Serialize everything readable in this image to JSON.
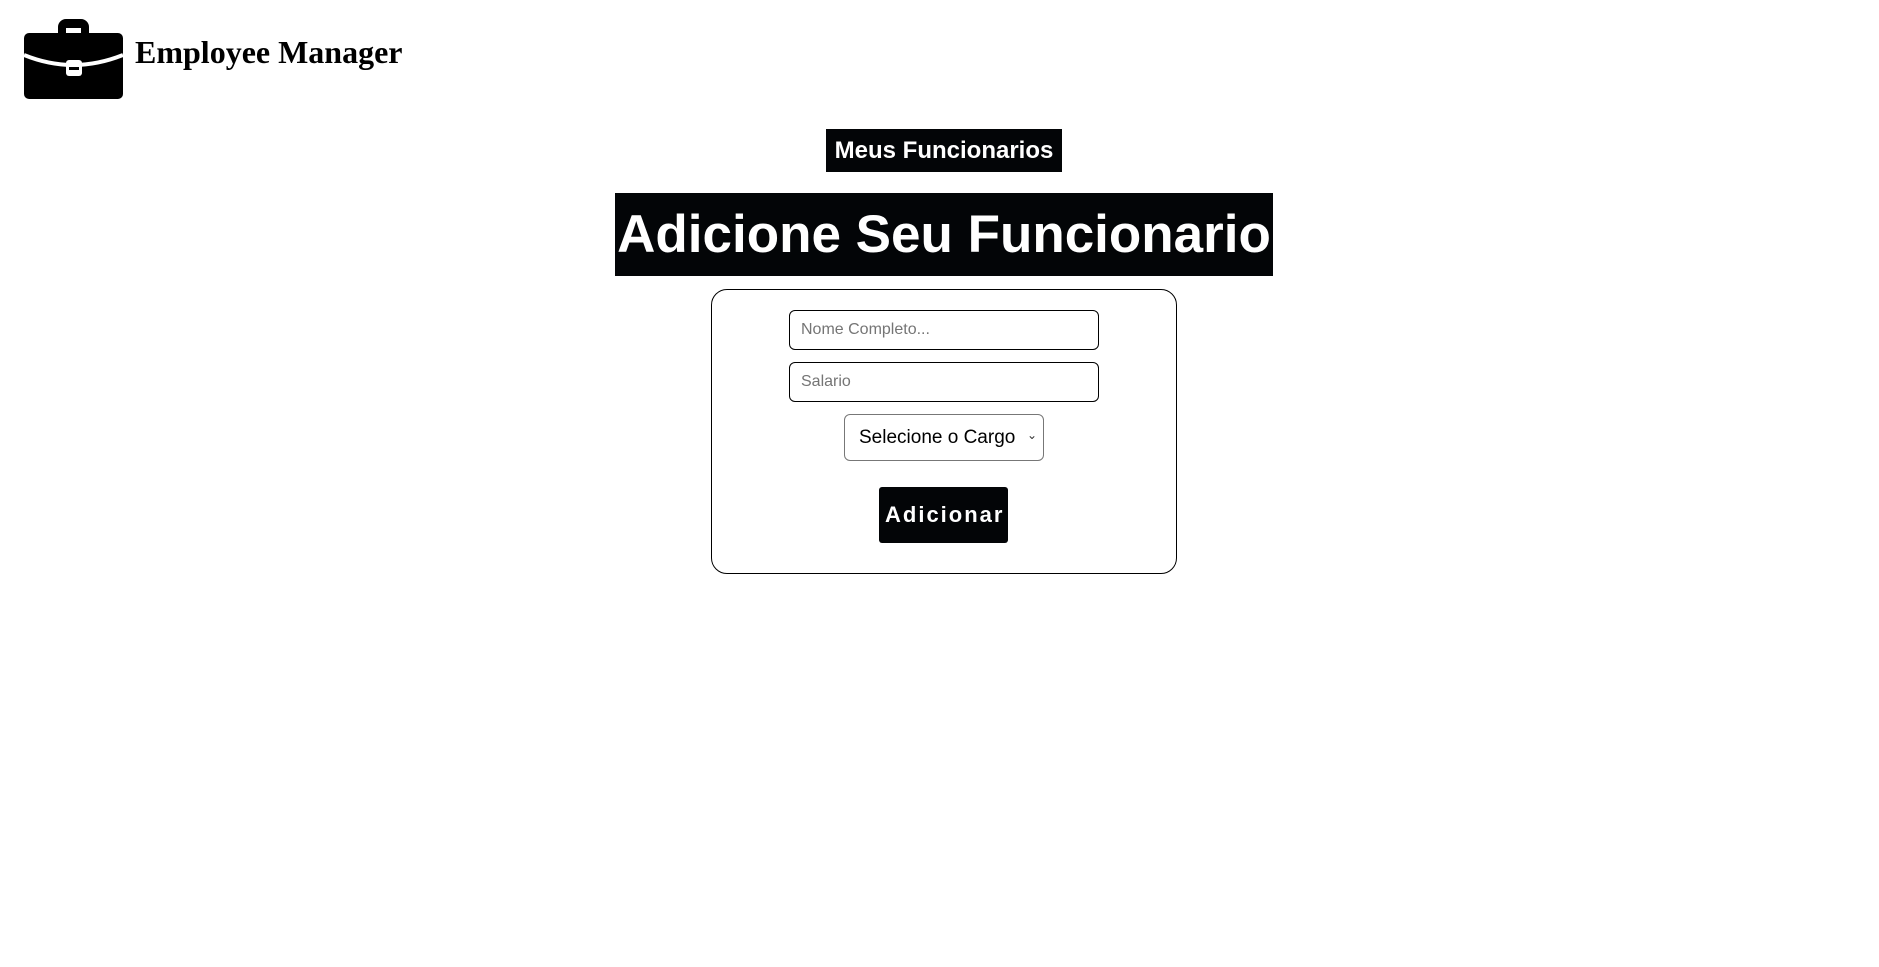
{
  "header": {
    "brand": "Employee Manager",
    "logo_icon": "briefcase-icon"
  },
  "nav": {
    "my_employees_label": "Meus Funcionarios"
  },
  "main": {
    "title": "Adicione Seu Funcionario",
    "form": {
      "name_placeholder": "Nome Completo...",
      "salary_placeholder": "Salario",
      "role_select_value": "Selecione o Cargo",
      "submit_label": "Adicionar"
    }
  },
  "colors": {
    "primary": "#030507",
    "background": "#ffffff"
  }
}
